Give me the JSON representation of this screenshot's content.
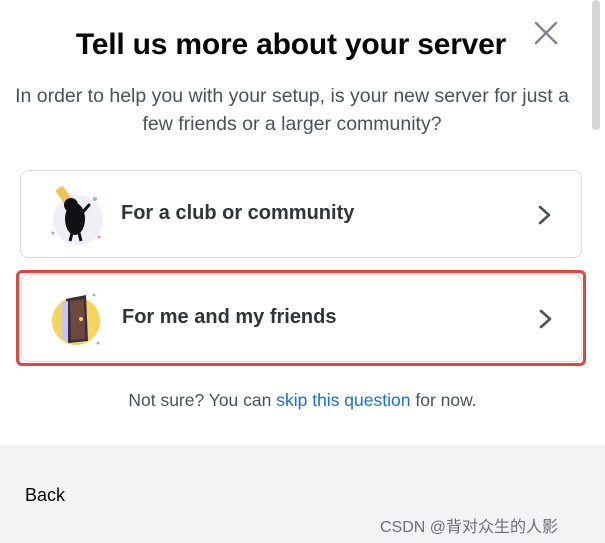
{
  "header": {
    "title": "Tell us more about your server",
    "subtitle": "In order to help you with your setup, is your new server for just a few friends or a larger community?"
  },
  "options": [
    {
      "label": "For a club or community",
      "icon": "club-mascot-icon"
    },
    {
      "label": "For me and my friends",
      "icon": "door-icon"
    }
  ],
  "footnote": {
    "prefix": "Not sure? You can ",
    "link": "skip this question",
    "suffix": " for now."
  },
  "footer": {
    "back_label": "Back",
    "watermark": "CSDN @背对众生的人影"
  },
  "colors": {
    "highlight": "#e0463e",
    "link": "#1a6fd0",
    "footer_bg": "#f2f3f5"
  }
}
